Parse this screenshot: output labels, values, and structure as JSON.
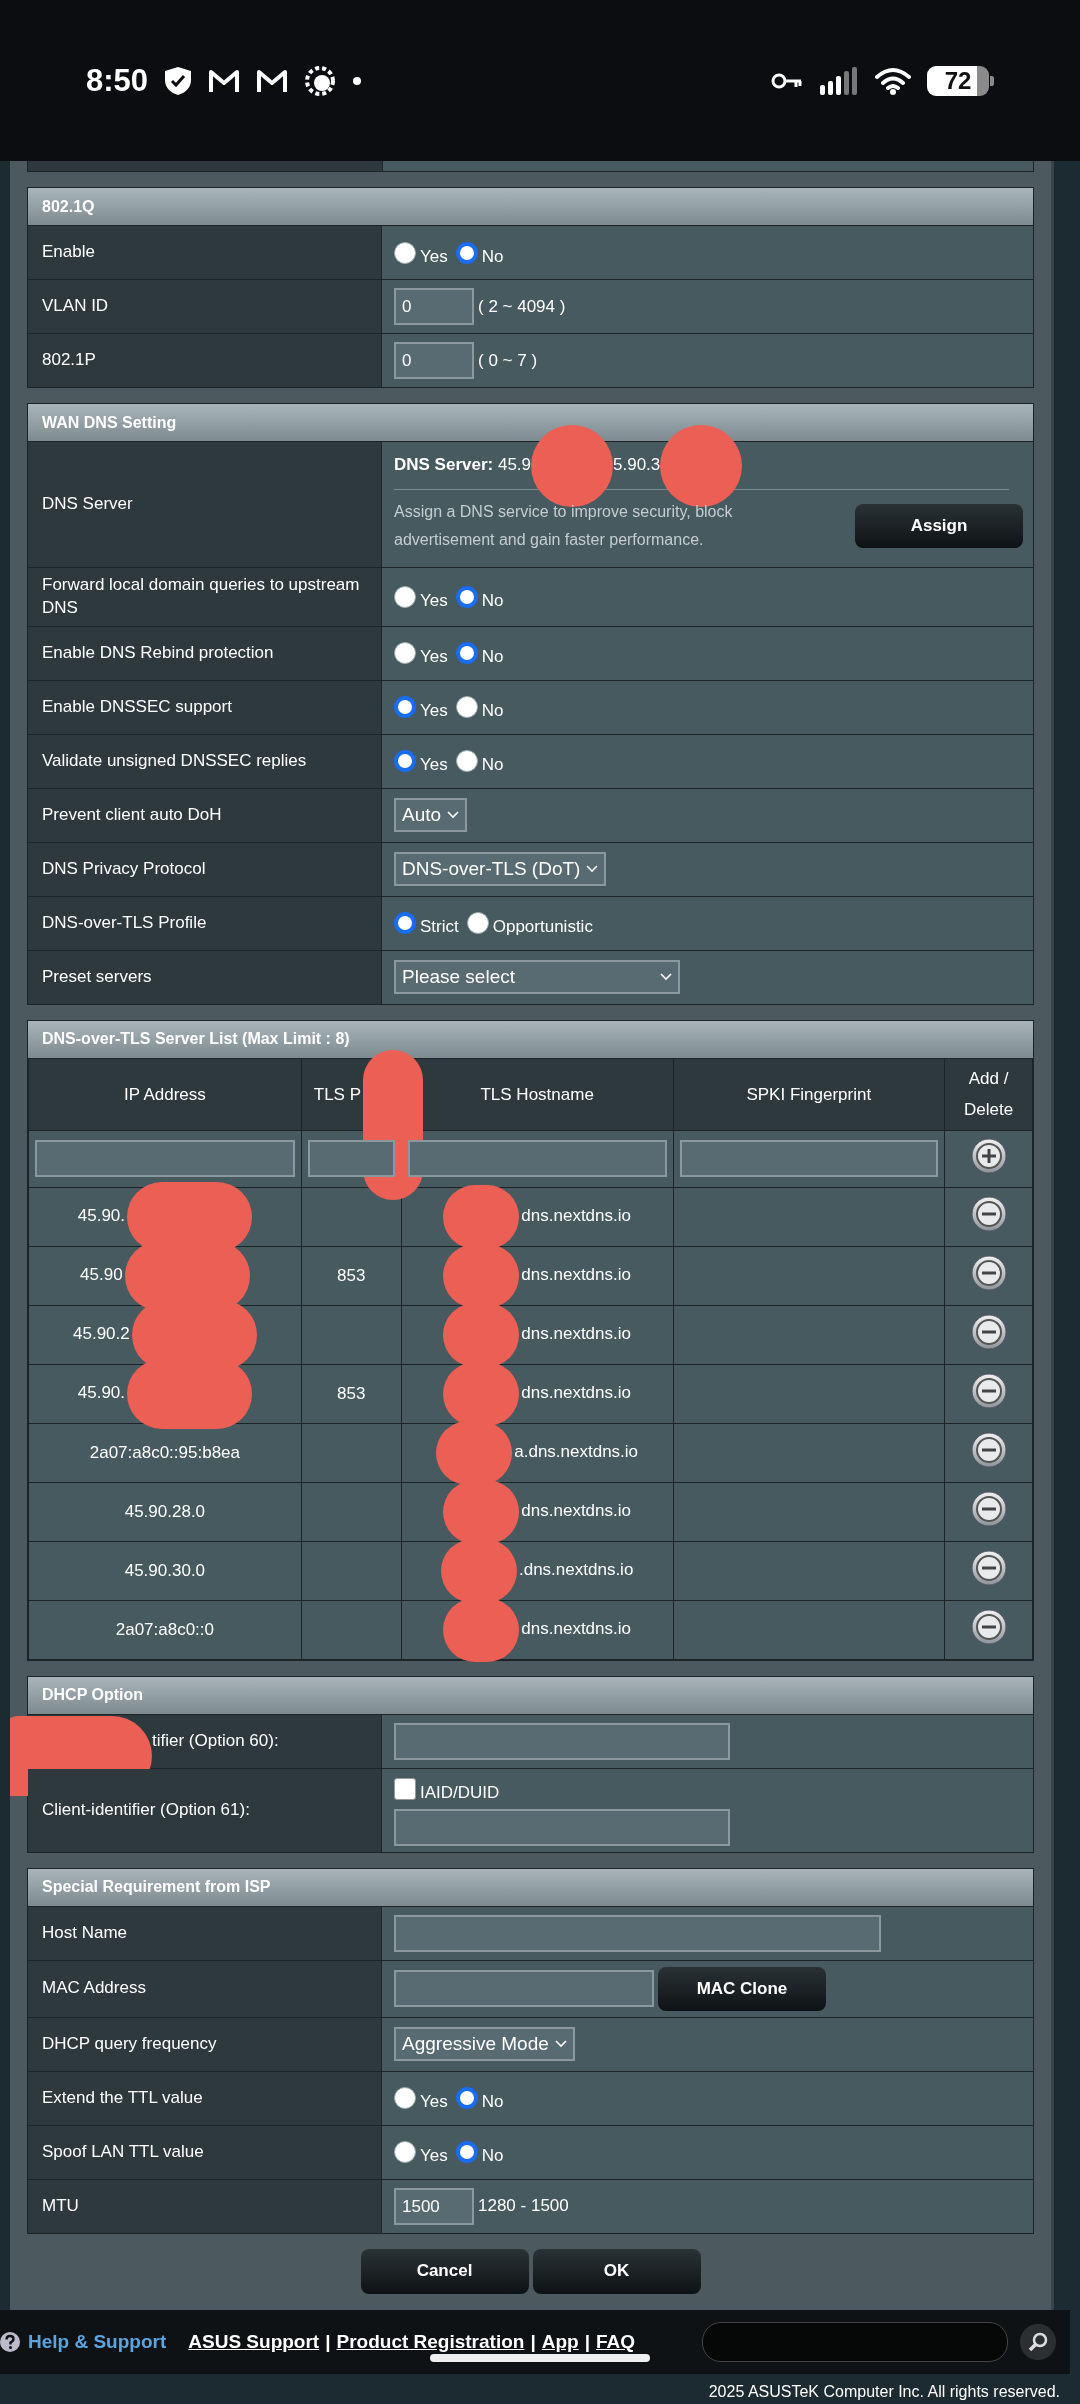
{
  "status_bar": {
    "time": "8:50",
    "battery": "72"
  },
  "sections": [
    {
      "title": "802.1Q",
      "rows": [
        {
          "label": "Enable",
          "kind": "radio",
          "options": [
            {
              "label": "Yes",
              "selected": false
            },
            {
              "label": "No",
              "selected": true
            }
          ]
        },
        {
          "label": "VLAN ID",
          "kind": "number",
          "value": "0",
          "hint": "( 2 ~ 4094 )"
        },
        {
          "label": "802.1P",
          "kind": "number",
          "value": "0",
          "hint": "( 0 ~ 7 )"
        }
      ]
    },
    {
      "title": "WAN DNS Setting",
      "rows": [
        {
          "label": "DNS Server",
          "kind": "dns",
          "server": [
            {
              "text": "**DNS Server:** 45.9",
              "redacted": true
            },
            {
              "text": "5.90.3",
              "redacted": true
            }
          ],
          "description": "Assign a DNS service to improve security, block advertisement and gain faster performance.",
          "button": "Assign"
        },
        {
          "label": "Forward local domain queries to upstream DNS",
          "kind": "radio",
          "options": [
            {
              "label": "Yes",
              "selected": false
            },
            {
              "label": "No",
              "selected": true
            }
          ]
        },
        {
          "label": "Enable DNS Rebind protection",
          "kind": "radio",
          "options": [
            {
              "label": "Yes",
              "selected": false
            },
            {
              "label": "No",
              "selected": true
            }
          ]
        },
        {
          "label": "Enable DNSSEC support",
          "kind": "radio",
          "options": [
            {
              "label": "Yes",
              "selected": true
            },
            {
              "label": "No",
              "selected": false
            }
          ]
        },
        {
          "label": "Validate unsigned DNSSEC replies",
          "kind": "radio",
          "options": [
            {
              "label": "Yes",
              "selected": true
            },
            {
              "label": "No",
              "selected": false
            }
          ]
        },
        {
          "label": "Prevent client auto DoH",
          "kind": "select",
          "value": "Auto"
        },
        {
          "label": "DNS Privacy Protocol",
          "kind": "select",
          "value": "DNS-over-TLS (DoT)"
        },
        {
          "label": "DNS-over-TLS Profile",
          "kind": "radio",
          "options": [
            {
              "label": "Strict",
              "selected": true
            },
            {
              "label": "Opportunistic",
              "selected": false
            }
          ]
        },
        {
          "label": "Preset servers",
          "kind": "wide_select",
          "value": "Please select"
        }
      ]
    },
    {
      "title": "DNS-over-TLS Server List (Max Limit : 8)",
      "kind": "table",
      "columns": [
        {
          "label": "IP Address"
        },
        {
          "label": "TLS P",
          "redacted": true
        },
        {
          "label": "TLS Hostname"
        },
        {
          "label": "SPKI Fingerprint"
        },
        {
          "label": "Add / Delete"
        }
      ],
      "rows": [
        {
          "ip": "45.90.",
          "ip_redacted": true,
          "hostname": "dns.nextdns.io",
          "hostname_redacted": true
        },
        {
          "ip": "45.90",
          "ip_redacted": true,
          "port": "853",
          "hostname": "dns.nextdns.io",
          "hostname_redacted": true
        },
        {
          "ip": "45.90.2",
          "ip_redacted": true,
          "hostname": "dns.nextdns.io",
          "hostname_redacted": true
        },
        {
          "ip": "45.90.",
          "ip_redacted": true,
          "port": "853",
          "hostname": "dns.nextdns.io",
          "hostname_redacted": true
        },
        {
          "ip": "2a07:a8c0::95:b8ea",
          "hostname": "a.dns.nextdns.io",
          "hostname_redacted": true
        },
        {
          "ip": "45.90.28.0",
          "hostname": "dns.nextdns.io",
          "hostname_redacted": true
        },
        {
          "ip": "45.90.30.0",
          "hostname": ".dns.nextdns.io",
          "hostname_redacted": true
        },
        {
          "ip": "2a07:a8c0::0",
          "hostname": "dns.nextdns.io",
          "hostname_redacted": true
        }
      ]
    },
    {
      "title": "DHCP Option",
      "rows": [
        {
          "label": "tifier (Option 60):",
          "label_redacted": true,
          "kind": "text"
        },
        {
          "label": "Client-identifier (Option 61):",
          "kind": "checkbox_text",
          "checkbox": {
            "label": "IAID/DUID",
            "checked": false
          }
        }
      ]
    },
    {
      "title": "Special Requirement from ISP",
      "rows": [
        {
          "label": "Host Name",
          "kind": "long_text"
        },
        {
          "label": "MAC Address",
          "kind": "text_button",
          "button": "MAC Clone"
        },
        {
          "label": "DHCP query frequency",
          "kind": "select",
          "value": "Aggressive Mode"
        },
        {
          "label": "Extend the TTL value",
          "kind": "radio",
          "options": [
            {
              "label": "Yes",
              "selected": false
            },
            {
              "label": "No",
              "selected": true
            }
          ]
        },
        {
          "label": "Spoof LAN TTL value",
          "kind": "radio",
          "options": [
            {
              "label": "Yes",
              "selected": false
            },
            {
              "label": "No",
              "selected": true
            }
          ]
        },
        {
          "label": "MTU",
          "kind": "number",
          "value": "1500",
          "hint": "1280 - 1500"
        }
      ]
    }
  ],
  "buttons": [
    "Cancel",
    "OK"
  ],
  "footer": {
    "help": "Help & Support",
    "links": [
      {
        "kind": "link",
        "text": "ASUS Support"
      },
      {
        "kind": "separator",
        "text": "|"
      },
      {
        "kind": "link",
        "text": "Product Registration"
      },
      {
        "kind": "separator",
        "text": "|"
      },
      {
        "kind": "link",
        "text": "App"
      },
      {
        "kind": "separator",
        "text": "|"
      },
      {
        "kind": "link",
        "text": "FAQ"
      }
    ],
    "copyright": "2025 ASUSTeK Computer Inc. All rights reserved."
  }
}
